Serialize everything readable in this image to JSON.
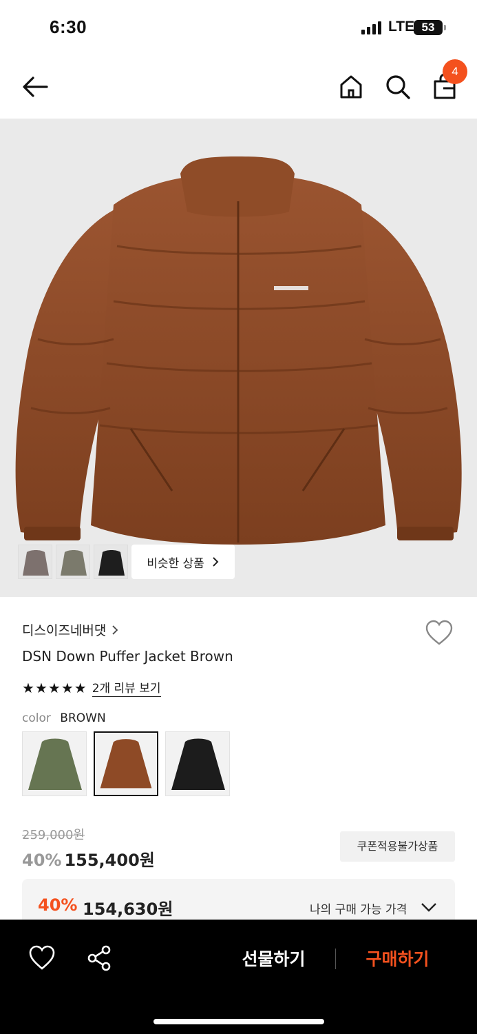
{
  "status_bar": {
    "time": "6:30",
    "network": "LTE",
    "battery": "53"
  },
  "nav": {
    "icons": [
      "back-arrow-icon",
      "home-icon",
      "search-icon",
      "shopping-bag-icon"
    ],
    "cart_count": "4"
  },
  "gallery": {
    "thumbnails": [
      {
        "color": "#7d716e"
      },
      {
        "color": "#7b7a6c"
      },
      {
        "color": "#1e1e1e"
      }
    ],
    "similar_label": "비슷한 상품",
    "similar_icon": "chevron-right-icon"
  },
  "product": {
    "brand": "디스이즈네버댓",
    "name": "DSN Down Puffer Jacket Brown",
    "rating_stars": 5,
    "review_link": "2개 리뷰 보기",
    "color_label": "color",
    "color_value": "BROWN",
    "color_options": [
      {
        "color": "#667552",
        "selected": false
      },
      {
        "color": "#8e4a26",
        "selected": true
      },
      {
        "color": "#1c1c1c",
        "selected": false
      }
    ]
  },
  "pricing": {
    "original_price": "259,000원",
    "discount": "40%",
    "sale_price": "155,400원",
    "coupon_badge": "쿠폰적용불가상품",
    "my_discount": "40%",
    "my_price": "154,630원",
    "my_price_label": "나의 구매 가능 가격"
  },
  "bottom_bar": {
    "gift_label": "선물하기",
    "buy_label": "구매하기"
  },
  "colors": {
    "accent": "#f4511e",
    "jacket": "#8e4a26"
  }
}
